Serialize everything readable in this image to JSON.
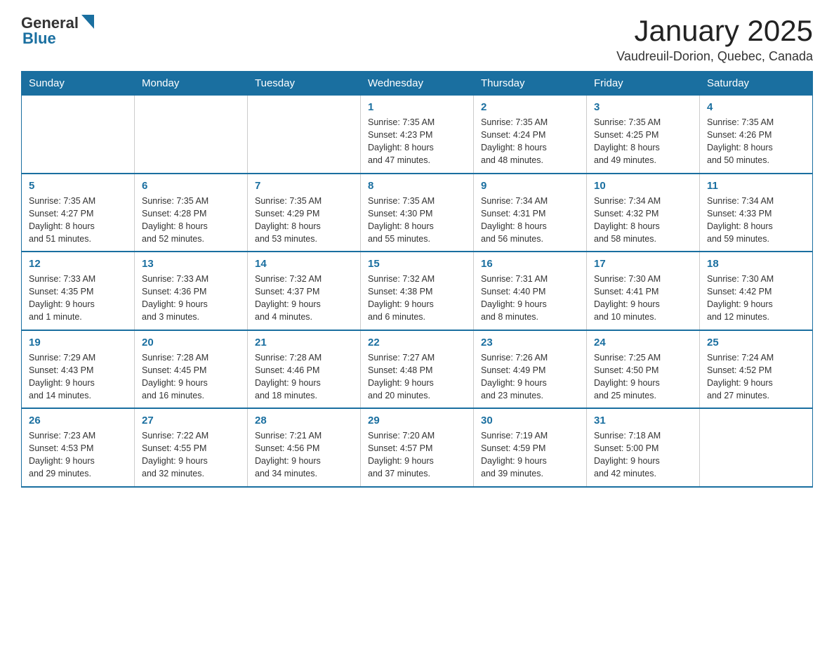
{
  "header": {
    "logo_general": "General",
    "logo_blue": "Blue",
    "month_title": "January 2025",
    "location": "Vaudreuil-Dorion, Quebec, Canada"
  },
  "weekdays": [
    "Sunday",
    "Monday",
    "Tuesday",
    "Wednesday",
    "Thursday",
    "Friday",
    "Saturday"
  ],
  "weeks": [
    [
      {
        "day": "",
        "info": ""
      },
      {
        "day": "",
        "info": ""
      },
      {
        "day": "",
        "info": ""
      },
      {
        "day": "1",
        "info": "Sunrise: 7:35 AM\nSunset: 4:23 PM\nDaylight: 8 hours\nand 47 minutes."
      },
      {
        "day": "2",
        "info": "Sunrise: 7:35 AM\nSunset: 4:24 PM\nDaylight: 8 hours\nand 48 minutes."
      },
      {
        "day": "3",
        "info": "Sunrise: 7:35 AM\nSunset: 4:25 PM\nDaylight: 8 hours\nand 49 minutes."
      },
      {
        "day": "4",
        "info": "Sunrise: 7:35 AM\nSunset: 4:26 PM\nDaylight: 8 hours\nand 50 minutes."
      }
    ],
    [
      {
        "day": "5",
        "info": "Sunrise: 7:35 AM\nSunset: 4:27 PM\nDaylight: 8 hours\nand 51 minutes."
      },
      {
        "day": "6",
        "info": "Sunrise: 7:35 AM\nSunset: 4:28 PM\nDaylight: 8 hours\nand 52 minutes."
      },
      {
        "day": "7",
        "info": "Sunrise: 7:35 AM\nSunset: 4:29 PM\nDaylight: 8 hours\nand 53 minutes."
      },
      {
        "day": "8",
        "info": "Sunrise: 7:35 AM\nSunset: 4:30 PM\nDaylight: 8 hours\nand 55 minutes."
      },
      {
        "day": "9",
        "info": "Sunrise: 7:34 AM\nSunset: 4:31 PM\nDaylight: 8 hours\nand 56 minutes."
      },
      {
        "day": "10",
        "info": "Sunrise: 7:34 AM\nSunset: 4:32 PM\nDaylight: 8 hours\nand 58 minutes."
      },
      {
        "day": "11",
        "info": "Sunrise: 7:34 AM\nSunset: 4:33 PM\nDaylight: 8 hours\nand 59 minutes."
      }
    ],
    [
      {
        "day": "12",
        "info": "Sunrise: 7:33 AM\nSunset: 4:35 PM\nDaylight: 9 hours\nand 1 minute."
      },
      {
        "day": "13",
        "info": "Sunrise: 7:33 AM\nSunset: 4:36 PM\nDaylight: 9 hours\nand 3 minutes."
      },
      {
        "day": "14",
        "info": "Sunrise: 7:32 AM\nSunset: 4:37 PM\nDaylight: 9 hours\nand 4 minutes."
      },
      {
        "day": "15",
        "info": "Sunrise: 7:32 AM\nSunset: 4:38 PM\nDaylight: 9 hours\nand 6 minutes."
      },
      {
        "day": "16",
        "info": "Sunrise: 7:31 AM\nSunset: 4:40 PM\nDaylight: 9 hours\nand 8 minutes."
      },
      {
        "day": "17",
        "info": "Sunrise: 7:30 AM\nSunset: 4:41 PM\nDaylight: 9 hours\nand 10 minutes."
      },
      {
        "day": "18",
        "info": "Sunrise: 7:30 AM\nSunset: 4:42 PM\nDaylight: 9 hours\nand 12 minutes."
      }
    ],
    [
      {
        "day": "19",
        "info": "Sunrise: 7:29 AM\nSunset: 4:43 PM\nDaylight: 9 hours\nand 14 minutes."
      },
      {
        "day": "20",
        "info": "Sunrise: 7:28 AM\nSunset: 4:45 PM\nDaylight: 9 hours\nand 16 minutes."
      },
      {
        "day": "21",
        "info": "Sunrise: 7:28 AM\nSunset: 4:46 PM\nDaylight: 9 hours\nand 18 minutes."
      },
      {
        "day": "22",
        "info": "Sunrise: 7:27 AM\nSunset: 4:48 PM\nDaylight: 9 hours\nand 20 minutes."
      },
      {
        "day": "23",
        "info": "Sunrise: 7:26 AM\nSunset: 4:49 PM\nDaylight: 9 hours\nand 23 minutes."
      },
      {
        "day": "24",
        "info": "Sunrise: 7:25 AM\nSunset: 4:50 PM\nDaylight: 9 hours\nand 25 minutes."
      },
      {
        "day": "25",
        "info": "Sunrise: 7:24 AM\nSunset: 4:52 PM\nDaylight: 9 hours\nand 27 minutes."
      }
    ],
    [
      {
        "day": "26",
        "info": "Sunrise: 7:23 AM\nSunset: 4:53 PM\nDaylight: 9 hours\nand 29 minutes."
      },
      {
        "day": "27",
        "info": "Sunrise: 7:22 AM\nSunset: 4:55 PM\nDaylight: 9 hours\nand 32 minutes."
      },
      {
        "day": "28",
        "info": "Sunrise: 7:21 AM\nSunset: 4:56 PM\nDaylight: 9 hours\nand 34 minutes."
      },
      {
        "day": "29",
        "info": "Sunrise: 7:20 AM\nSunset: 4:57 PM\nDaylight: 9 hours\nand 37 minutes."
      },
      {
        "day": "30",
        "info": "Sunrise: 7:19 AM\nSunset: 4:59 PM\nDaylight: 9 hours\nand 39 minutes."
      },
      {
        "day": "31",
        "info": "Sunrise: 7:18 AM\nSunset: 5:00 PM\nDaylight: 9 hours\nand 42 minutes."
      },
      {
        "day": "",
        "info": ""
      }
    ]
  ]
}
